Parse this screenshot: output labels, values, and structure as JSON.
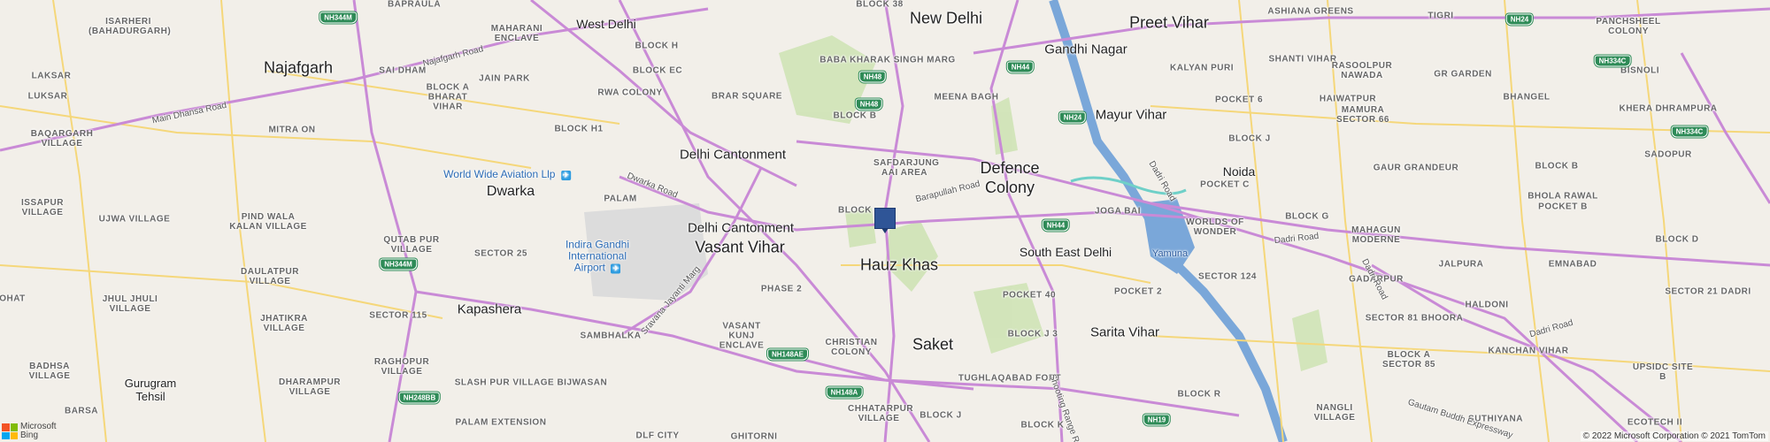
{
  "cities": [
    {
      "name": "New Delhi"
    },
    {
      "name": "Preet Vihar"
    },
    {
      "name": "Najafgarh"
    },
    {
      "name": "Gandhi Nagar"
    },
    {
      "name": "Mayur Vihar"
    },
    {
      "name": "Delhi Cantonment"
    },
    {
      "name": "Defence Colony"
    },
    {
      "name": "Noida"
    },
    {
      "name": "Dwarka"
    },
    {
      "name": "Delhi Cantonment"
    },
    {
      "name": "Vasant Vihar"
    },
    {
      "name": "Hauz Khas"
    },
    {
      "name": "South East Delhi"
    },
    {
      "name": "Kapashera"
    },
    {
      "name": "Saket"
    },
    {
      "name": "Sarita Vihar"
    },
    {
      "name": "Gurugram Tehsil"
    },
    {
      "name": "West Delhi"
    }
  ],
  "areas": [
    {
      "name": "ISARHERI (BAHADURGARH)"
    },
    {
      "name": "BAPRAULA"
    },
    {
      "name": "MAHARANI ENCLAVE"
    },
    {
      "name": "BLOCK 38"
    },
    {
      "name": "ASHIANA GREENS"
    },
    {
      "name": "TIGRI"
    },
    {
      "name": "PANCHSHEEL COLONY"
    },
    {
      "name": "SAI DHAM"
    },
    {
      "name": "BLOCK H"
    },
    {
      "name": "BABA KHARAK SINGH MARG"
    },
    {
      "name": "SHANTI VIHAR"
    },
    {
      "name": "GR GARDEN"
    },
    {
      "name": "BISNOLI"
    },
    {
      "name": "LAKSAR"
    },
    {
      "name": "JAIN PARK"
    },
    {
      "name": "BLOCK EC"
    },
    {
      "name": "KALYAN PURI"
    },
    {
      "name": "BLOCK A BHARAT VIHAR"
    },
    {
      "name": "RWA COLONY"
    },
    {
      "name": "MEENA BAGH"
    },
    {
      "name": "RASOOLPUR NAWADA"
    },
    {
      "name": "HAIWATPUR"
    },
    {
      "name": "BHANGEL"
    },
    {
      "name": "LUKSAR"
    },
    {
      "name": "BRAR SQUARE"
    },
    {
      "name": "BLOCK B"
    },
    {
      "name": "POCKET 6"
    },
    {
      "name": "KHERA DHRAMPURA"
    },
    {
      "name": "MITRA ON"
    },
    {
      "name": "BLOCK H1"
    },
    {
      "name": "MAMURA SECTOR 66"
    },
    {
      "name": "SADOPUR"
    },
    {
      "name": "BAQARGARH VILLAGE"
    },
    {
      "name": "BLOCK J"
    },
    {
      "name": "SAFDARJUNG AAI AREA"
    },
    {
      "name": "GAUR GRANDEUR"
    },
    {
      "name": "BLOCK B"
    },
    {
      "name": "POCKET C"
    },
    {
      "name": "BHOLA RAWAL"
    },
    {
      "name": "ISSAPUR VILLAGE"
    },
    {
      "name": "UJWA VILLAGE"
    },
    {
      "name": "PALAM"
    },
    {
      "name": "BLOCK"
    },
    {
      "name": "JOGA BAI"
    },
    {
      "name": "BLOCK G"
    },
    {
      "name": "POCKET B"
    },
    {
      "name": "PIND WALA KALAN VILLAGE"
    },
    {
      "name": "WORLDS OF WONDER"
    },
    {
      "name": "MAHAGUN MODERNE"
    },
    {
      "name": "BLOCK D"
    },
    {
      "name": "QUTAB PUR VILLAGE"
    },
    {
      "name": "SECTOR 25"
    },
    {
      "name": "SECTOR 124"
    },
    {
      "name": "GADARPUR"
    },
    {
      "name": "JALPURA"
    },
    {
      "name": "EMNABAD"
    },
    {
      "name": "DAULATPUR VILLAGE"
    },
    {
      "name": "PHASE 2"
    },
    {
      "name": "POCKET 40"
    },
    {
      "name": "POCKET 2"
    },
    {
      "name": "HALDONI"
    },
    {
      "name": "SECTOR 21 DADRI"
    },
    {
      "name": "OHAT"
    },
    {
      "name": "JHUL JHULI VILLAGE"
    },
    {
      "name": "JHATIKRA VILLAGE"
    },
    {
      "name": "SECTOR 115"
    },
    {
      "name": "SAMBHALKA"
    },
    {
      "name": "VASANT KUNJ ENCLAVE"
    },
    {
      "name": "BLOCK J 3"
    },
    {
      "name": "SECTOR 81 BHOORA"
    },
    {
      "name": "BLOCK A SECTOR 85"
    },
    {
      "name": "KANCHAN VIHAR"
    },
    {
      "name": "UPSIDC SITE B"
    },
    {
      "name": "BADHSA VILLAGE"
    },
    {
      "name": "RAGHOPUR VILLAGE"
    },
    {
      "name": "CHRISTIAN COLONY"
    },
    {
      "name": "TUGHLAQABAD FORT"
    },
    {
      "name": "DHARAMPUR VILLAGE"
    },
    {
      "name": "SLASH PUR VILLAGE BIJWASAN"
    },
    {
      "name": "NANGLI VILLAGE"
    },
    {
      "name": "BLOCK R"
    },
    {
      "name": "SUTHIYANA"
    },
    {
      "name": "CHHATARPUR VILLAGE"
    },
    {
      "name": "BLOCK J"
    },
    {
      "name": "BLOCK K"
    },
    {
      "name": "BARSA"
    },
    {
      "name": "PALAM EXTENSION"
    },
    {
      "name": "DLF CITY"
    },
    {
      "name": "GHITORNI"
    },
    {
      "name": "ECOTECH II"
    }
  ],
  "roads": [
    {
      "name": "Najafgarh Road"
    },
    {
      "name": "Main Dhansa Road"
    },
    {
      "name": "Dwarka Road"
    },
    {
      "name": "Barapullah Road"
    },
    {
      "name": "Dadri Road"
    },
    {
      "name": "Dadri Road"
    },
    {
      "name": "Dadri Road"
    },
    {
      "name": "Dadri Road"
    },
    {
      "name": "Sravana Jayanti Marg"
    },
    {
      "name": "Gautam Buddh Expressway"
    },
    {
      "name": "Shooting Range Road"
    }
  ],
  "shields": [
    {
      "name": "NH344M"
    },
    {
      "name": "NH24"
    },
    {
      "name": "NH334C"
    },
    {
      "name": "NH48"
    },
    {
      "name": "NH48"
    },
    {
      "name": "NH44"
    },
    {
      "name": "NH24"
    },
    {
      "name": "NH334C"
    },
    {
      "name": "NH44"
    },
    {
      "name": "NH344M"
    },
    {
      "name": "NH148AE"
    },
    {
      "name": "NH248BB"
    },
    {
      "name": "NH148A"
    },
    {
      "name": "NH19"
    }
  ],
  "water": [
    {
      "name": "Yamuna"
    }
  ],
  "pois": [
    {
      "name": "World Wide Aviation Llp"
    },
    {
      "name": "Indira Gandhi International Airport"
    }
  ],
  "logo": {
    "line1": "Microsoft",
    "line2": "Bing"
  },
  "copyright": "© 2022 Microsoft Corporation © 2021 TomTom",
  "colors": {
    "major_road": "#c98ad6",
    "minor_road": "#f5d77a",
    "water": "#7aa7d9",
    "park": "#c8e0b0",
    "pin": "#2f5597"
  }
}
